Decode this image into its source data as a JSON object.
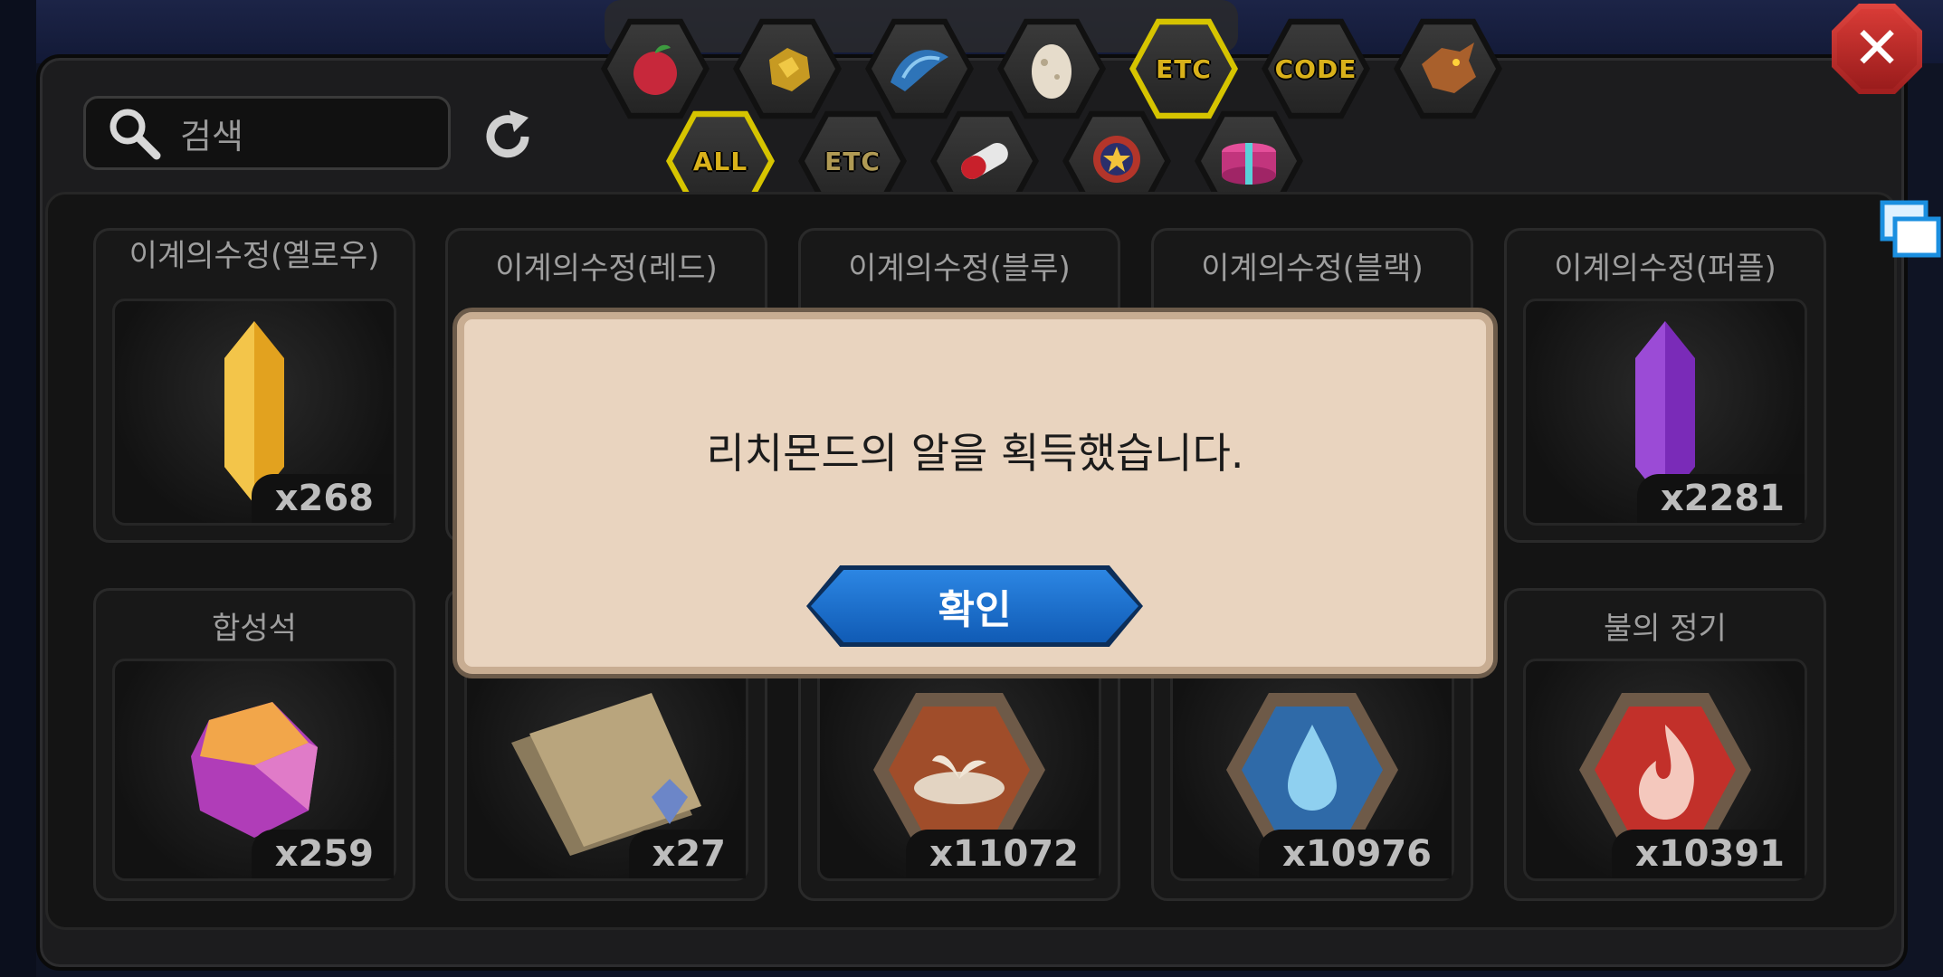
{
  "search": {
    "placeholder": "검색"
  },
  "tabs_top": [
    {
      "name": "fruit-tab",
      "icon": "red-fruit-icon"
    },
    {
      "name": "ore-tab",
      "icon": "gold-ore-icon"
    },
    {
      "name": "scale-tab",
      "icon": "blue-scale-icon"
    },
    {
      "name": "egg-tab",
      "icon": "egg-icon"
    },
    {
      "name": "etc-tab",
      "label": "ETC",
      "active": true
    },
    {
      "name": "code-tab",
      "label": "CODE"
    },
    {
      "name": "dragon-tab",
      "icon": "dragon-icon"
    }
  ],
  "tabs_sub": [
    {
      "name": "all-subtab",
      "label": "ALL",
      "active": true
    },
    {
      "name": "etc-subtab",
      "label": "ETC"
    },
    {
      "name": "pill-subtab",
      "icon": "pill-icon"
    },
    {
      "name": "medal-subtab",
      "icon": "medal-icon"
    },
    {
      "name": "giftbox-subtab",
      "icon": "gift-box-icon"
    }
  ],
  "items_row1": [
    {
      "name": "이계의수정(옐로우)",
      "count": "x268",
      "icon": "yellow-crystal-icon"
    },
    {
      "name": "이계의수정(레드)",
      "count": "",
      "icon": "red-crystal-icon"
    },
    {
      "name": "이계의수정(블루)",
      "count": "",
      "icon": "blue-crystal-icon"
    },
    {
      "name": "이계의수정(블랙)",
      "count": "",
      "icon": "black-crystal-icon"
    },
    {
      "name": "이계의수정(퍼플)",
      "count": "x2281",
      "icon": "purple-crystal-icon"
    }
  ],
  "items_row2": [
    {
      "name": "합성석",
      "count": "x259",
      "icon": "synthesis-stone-icon"
    },
    {
      "name": "",
      "count": "x27",
      "icon": "scroll-icon"
    },
    {
      "name": "",
      "count": "x11072",
      "icon": "earth-essence-icon"
    },
    {
      "name": "",
      "count": "x10976",
      "icon": "water-essence-icon"
    },
    {
      "name": "불의 정기",
      "count": "x10391",
      "icon": "fire-essence-icon"
    }
  ],
  "dialog": {
    "message": "리치몬드의 알을 획득했습니다.",
    "confirm_label": "확인"
  },
  "colors": {
    "active_tab": "#d6c400",
    "confirm_button": "#1a6fd1",
    "close_button": "#c8302c",
    "dialog_bg": "#e9d4bf"
  }
}
